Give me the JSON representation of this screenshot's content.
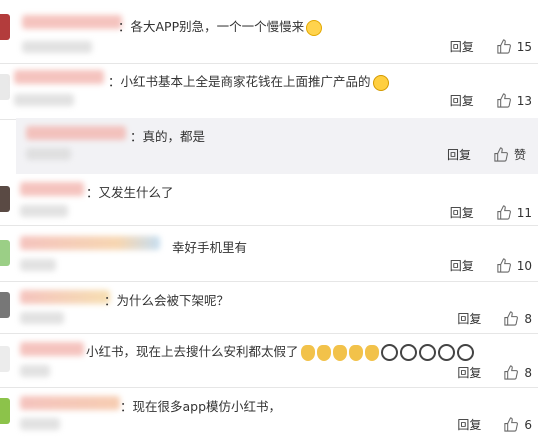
{
  "comments": [
    {
      "text": "：各大APP别急，一个一个慢慢来",
      "reply": "回复",
      "likes": "15",
      "emoji": [
        "smile"
      ]
    },
    {
      "text": "：小红书基本上全是商家花钱在上面推广产品的",
      "reply": "回复",
      "likes": "13",
      "emoji": [
        "laugh"
      ]
    },
    {
      "text": "：真的，都是",
      "reply": "回复",
      "likes": "赞",
      "emoji": []
    },
    {
      "text": "：又发生什么了",
      "reply": "回复",
      "likes": "11",
      "emoji": []
    },
    {
      "text": "幸好手机里有",
      "reply": "回复",
      "likes": "10",
      "emoji": []
    },
    {
      "text": "：为什么会被下架呢？",
      "reply": "回复",
      "likes": "8",
      "emoji": []
    },
    {
      "text": "小红书，现在上去搜什么安利都太假了",
      "reply": "回复",
      "likes": "8",
      "emoji": [
        "man",
        "man",
        "man",
        "man",
        "man",
        "panda",
        "panda",
        "panda",
        "panda",
        "panda"
      ]
    },
    {
      "text": "：现在很多app模仿小红书，",
      "reply": "回复",
      "likes": "6",
      "emoji": []
    }
  ],
  "icons": {
    "like": "thumbs-up-icon"
  },
  "colors": {
    "text": "#333333",
    "divider": "#e6e6e6",
    "sub_bg": "#f2f2f5"
  }
}
